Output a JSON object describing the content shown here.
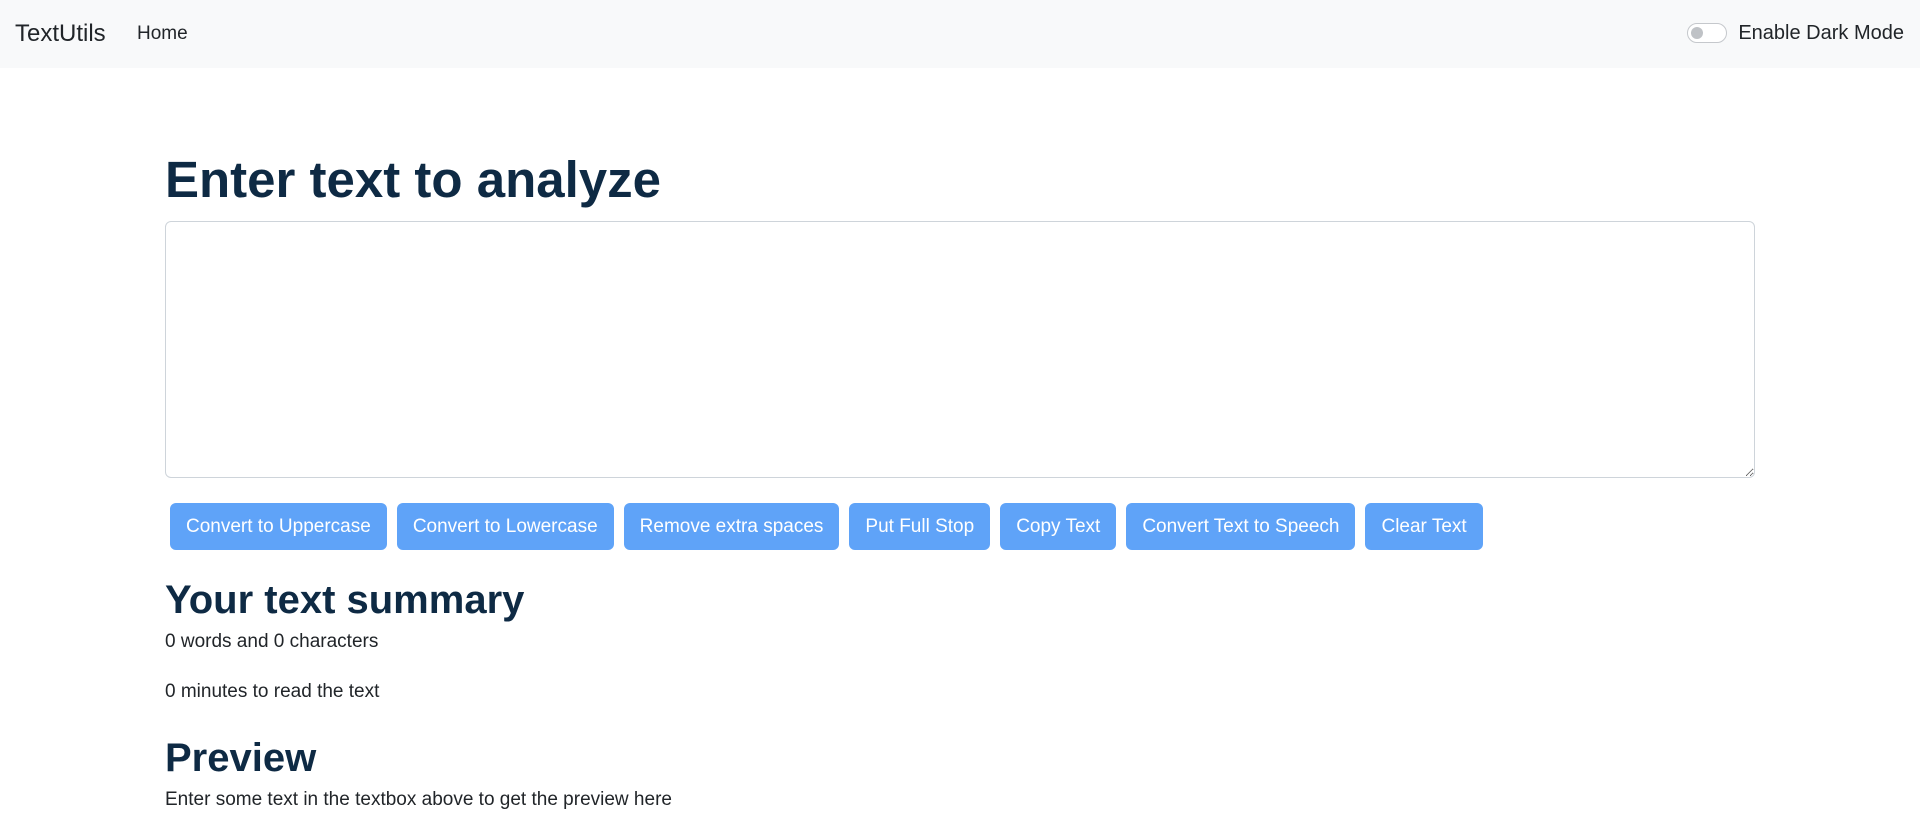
{
  "navbar": {
    "brand": "TextUtils",
    "links": [
      "Home"
    ],
    "dark_mode_label": "Enable Dark Mode",
    "dark_mode_enabled": false
  },
  "main": {
    "heading": "Enter text to analyze",
    "textarea_value": "",
    "buttons": [
      "Convert to Uppercase",
      "Convert to Lowercase",
      "Remove extra spaces",
      "Put Full Stop",
      "Copy Text",
      "Convert Text to Speech",
      "Clear Text"
    ],
    "summary": {
      "heading": "Your text summary",
      "word_char_count": "0 words and 0 characters",
      "read_time": "0 minutes to read the text"
    },
    "preview": {
      "heading": "Preview",
      "text": "Enter some text in the textbox above to get the preview here"
    }
  },
  "colors": {
    "navbar_bg": "#f8f9fa",
    "button_bg": "#5fa3f8",
    "heading_color": "#0e2a44"
  }
}
